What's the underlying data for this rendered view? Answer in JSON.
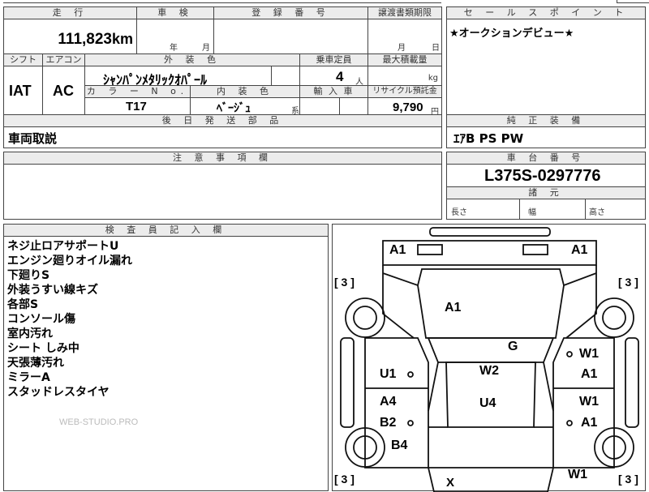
{
  "headers": {
    "mileage": "走 行",
    "inspection": "車 検",
    "registration": "登 録 番 号",
    "transfer_deadline": "譲渡書類期限",
    "sales_point": "セ ー ル ス ポ イ ン ト",
    "shift": "シフト",
    "aircon": "エアコン",
    "exterior_color": "外 装 色",
    "capacity": "乗車定員",
    "max_load": "最大積載量",
    "color_no": "カ ラ ー N o.",
    "interior_color": "内 装 色",
    "import": "輸 入 車",
    "recycle": "リサイクル預託金",
    "rear_parts": "後 日 発 送 部 品",
    "genuine_equipment": "純 正 装 備",
    "notes": "注 意 事 項 欄",
    "chassis_number": "車 台 番 号",
    "dimensions": "諸 元",
    "inspector": "検 査 員 記 入 欄"
  },
  "vehicle": {
    "mileage": "111,823",
    "mileage_unit": "km",
    "inspection_year_label": "年",
    "inspection_month_label": "月",
    "transfer_month_label": "月",
    "transfer_day_label": "日",
    "shift": "IAT",
    "aircon": "AC",
    "exterior_color": "ｼｬﾝﾊﾟﾝﾒﾀﾘｯｸｵﾊﾟｰﾙ",
    "capacity": "4",
    "capacity_unit": "人",
    "max_load_unit": "kg",
    "color_no": "T17",
    "interior_color": "ﾍﾞｰｼﾞｭ",
    "interior_suffix": "系",
    "recycle_fee": "9,790",
    "recycle_unit": "円",
    "rear_parts": "車両取説",
    "genuine_equipment": "ｴｱB PS PW",
    "chassis_number": "L375S-0297776",
    "dim_length": "長さ",
    "dim_width": "幅",
    "dim_height": "高さ"
  },
  "sales_point": "★オークションデビュー★",
  "inspector_notes": [
    "ネジ止ロアサポートU",
    "エンジン廻りオイル漏れ",
    "下廻りS",
    "外装うすい線キズ",
    "各部S",
    "コンソール傷",
    "室内汚れ",
    "シート しみ中",
    "天張薄汚れ",
    "ミラーA",
    "スタッドレスタイヤ"
  ],
  "watermark": "WEB-STUDIO.PRO",
  "diagram_marks": {
    "front_left": "A1",
    "front_right": "A1",
    "hood": "A1",
    "tire_fl": "[ 3 ]",
    "tire_fr": "[ 3 ]",
    "tire_rl": "[ 3 ]",
    "tire_rr": "[ 3 ]",
    "windshield": "G",
    "left_front_door": "U1",
    "roof": "W2",
    "right_front_door_top": "W1",
    "right_front_door_bottom": "A1",
    "left_rear_door_top": "A4",
    "left_rear_door_bottom": "B2",
    "roof_rear": "U4",
    "right_rear_door_top": "W1",
    "right_rear_door_bottom": "A1",
    "left_rear_fender": "B4",
    "right_rear_fender": "W1",
    "rear": "X"
  }
}
